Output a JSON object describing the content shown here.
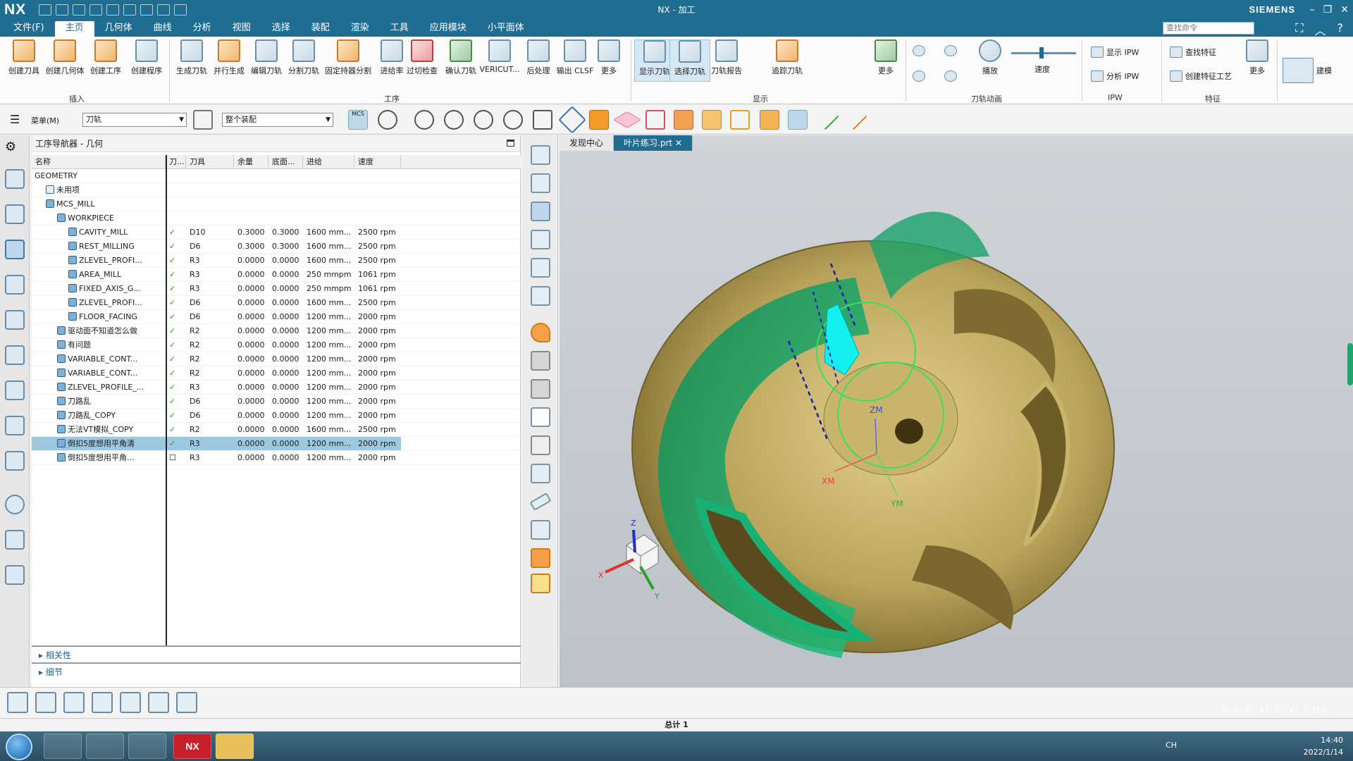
{
  "app": {
    "logo": "NX",
    "title": "NX - 加工",
    "brand": "SIEMENS",
    "window_controls": [
      "–",
      "❐",
      "✕"
    ]
  },
  "menu": {
    "tabs": [
      "文件(F)",
      "主页",
      "几何体",
      "曲线",
      "分析",
      "视图",
      "选择",
      "装配",
      "渲染",
      "工具",
      "应用模块",
      "小平面体"
    ],
    "active_tab": "主页",
    "search_placeholder": "查找命令"
  },
  "ribbon": {
    "insert_buttons": [
      "创建刀具",
      "创建几何体",
      "创建工序",
      "创建程序"
    ],
    "insert_group": "插入",
    "op_buttons": [
      "生成刀轨",
      "并行生成",
      "编辑刀轨",
      "分割刀轨",
      "固定持器分割",
      "进给率",
      "过切检查",
      "确认刀轨",
      "VERICUT...",
      "后处理",
      "输出 CLSF",
      "更多"
    ],
    "op_group": "工序",
    "display_buttons": [
      "显示刀轨",
      "选择刀轨",
      "刀轨报告",
      "追踪刀轨",
      "更多"
    ],
    "display_group": "显示",
    "anim_buttons": [
      "播放"
    ],
    "speed_label": "速度",
    "anim_group": "刀轨动画",
    "ipw_buttons": [
      "显示 IPW",
      "分析 IPW"
    ],
    "ipw_group": "IPW",
    "feature_buttons": [
      "查找特征",
      "创建特征工艺",
      "更多"
    ],
    "feature_group": "特征",
    "model_button": "建模"
  },
  "toolbar2": {
    "menu_label": "菜单(M)",
    "filter_value": "刀轨",
    "scope_value": "整个装配",
    "mcs_label": "MCS"
  },
  "navigator": {
    "title": "工序导航器 - 几何",
    "columns": [
      "名称",
      "刀...",
      "刀具",
      "余量",
      "底面...",
      "进给",
      "速度"
    ],
    "rows": [
      {
        "name": "GEOMETRY",
        "status": "",
        "tool": "",
        "stock": "",
        "floor": "",
        "feed": "",
        "speed": "",
        "indent": 0,
        "icon": ""
      },
      {
        "name": "未用项",
        "status": "",
        "tool": "",
        "stock": "",
        "floor": "",
        "feed": "",
        "speed": "",
        "indent": 1,
        "icon": "folder"
      },
      {
        "name": "MCS_MILL",
        "status": "",
        "tool": "",
        "stock": "",
        "floor": "",
        "feed": "",
        "speed": "",
        "indent": 1,
        "icon": "mcs"
      },
      {
        "name": "WORKPIECE",
        "status": "",
        "tool": "",
        "stock": "",
        "floor": "",
        "feed": "",
        "speed": "",
        "indent": 2,
        "icon": "workpiece"
      },
      {
        "name": "CAVITY_MILL",
        "status": "✓",
        "tool": "D10",
        "stock": "0.3000",
        "floor": "0.3000",
        "feed": "1600 mm...",
        "speed": "2500 rpm",
        "indent": 3,
        "icon": "op"
      },
      {
        "name": "REST_MILLING",
        "status": "✓",
        "tool": "D6",
        "stock": "0.3000",
        "floor": "0.3000",
        "feed": "1600 mm...",
        "speed": "2500 rpm",
        "indent": 3,
        "icon": "op"
      },
      {
        "name": "ZLEVEL_PROFI...",
        "status": "✓",
        "tool": "R3",
        "stock": "0.0000",
        "floor": "0.0000",
        "feed": "1600 mm...",
        "speed": "2500 rpm",
        "indent": 3,
        "icon": "op"
      },
      {
        "name": "AREA_MILL",
        "status": "✓",
        "tool": "R3",
        "stock": "0.0000",
        "floor": "0.0000",
        "feed": "250 mmpm",
        "speed": "1061 rpm",
        "indent": 3,
        "icon": "op"
      },
      {
        "name": "FIXED_AXIS_G...",
        "status": "✓",
        "tool": "R3",
        "stock": "0.0000",
        "floor": "0.0000",
        "feed": "250 mmpm",
        "speed": "1061 rpm",
        "indent": 3,
        "icon": "op"
      },
      {
        "name": "ZLEVEL_PROFI...",
        "status": "✓",
        "tool": "D6",
        "stock": "0.0000",
        "floor": "0.0000",
        "feed": "1600 mm...",
        "speed": "2500 rpm",
        "indent": 3,
        "icon": "op"
      },
      {
        "name": "FLOOR_FACING",
        "status": "✓",
        "tool": "D6",
        "stock": "0.0000",
        "floor": "0.0000",
        "feed": "1200 mm...",
        "speed": "2000 rpm",
        "indent": 3,
        "icon": "op"
      },
      {
        "name": "驱动面不知道怎么做",
        "status": "✓",
        "tool": "R2",
        "stock": "0.0000",
        "floor": "0.0000",
        "feed": "1200 mm...",
        "speed": "2000 rpm",
        "indent": 2,
        "icon": "op"
      },
      {
        "name": "有问题",
        "status": "✓",
        "tool": "R2",
        "stock": "0.0000",
        "floor": "0.0000",
        "feed": "1200 mm...",
        "speed": "2000 rpm",
        "indent": 2,
        "icon": "op"
      },
      {
        "name": "VARIABLE_CONT...",
        "status": "✓",
        "tool": "R2",
        "stock": "0.0000",
        "floor": "0.0000",
        "feed": "1200 mm...",
        "speed": "2000 rpm",
        "indent": 2,
        "icon": "op"
      },
      {
        "name": "VARIABLE_CONT...",
        "status": "✓",
        "tool": "R2",
        "stock": "0.0000",
        "floor": "0.0000",
        "feed": "1200 mm...",
        "speed": "2000 rpm",
        "indent": 2,
        "icon": "op"
      },
      {
        "name": "ZLEVEL_PROFILE_...",
        "status": "✓",
        "tool": "R3",
        "stock": "0.0000",
        "floor": "0.0000",
        "feed": "1200 mm...",
        "speed": "2000 rpm",
        "indent": 2,
        "icon": "op"
      },
      {
        "name": "刀路乱",
        "status": "✓",
        "tool": "D6",
        "stock": "0.0000",
        "floor": "0.0000",
        "feed": "1200 mm...",
        "speed": "2000 rpm",
        "indent": 2,
        "icon": "op"
      },
      {
        "name": "刀路乱_COPY",
        "status": "✓",
        "tool": "D6",
        "stock": "0.0000",
        "floor": "0.0000",
        "feed": "1200 mm...",
        "speed": "2000 rpm",
        "indent": 2,
        "icon": "op"
      },
      {
        "name": "无法VT模拟_COPY",
        "status": "✓",
        "tool": "R2",
        "stock": "0.0000",
        "floor": "0.0000",
        "feed": "1600 mm...",
        "speed": "2500 rpm",
        "indent": 2,
        "icon": "op"
      },
      {
        "name": "倒扣5度想用平角清",
        "status": "✓",
        "tool": "R3",
        "stock": "0.0000",
        "floor": "0.0000",
        "feed": "1200 mm...",
        "speed": "2000 rpm",
        "indent": 2,
        "icon": "op",
        "selected": true
      },
      {
        "name": "倒扣5度想用平角...",
        "status": "☐",
        "tool": "R3",
        "stock": "0.0000",
        "floor": "0.0000",
        "feed": "1200 mm...",
        "speed": "2000 rpm",
        "indent": 2,
        "icon": "op"
      }
    ],
    "sections": [
      "相关性",
      "细节"
    ]
  },
  "viewport": {
    "tabs": [
      "发现中心",
      "叶片练习.prt"
    ],
    "active_tab": "叶片练习.prt",
    "axis_labels": {
      "x": "X",
      "y": "Y",
      "z": "Z",
      "xm": "XM",
      "ym": "YM",
      "zm": "ZM"
    }
  },
  "status": {
    "total": "总计 1"
  },
  "taskbar": {
    "lang": "CH",
    "time": "14:40",
    "date": "2022/1/14",
    "nx_label": "NX"
  },
  "watermark": "WWW.3DSJW.COM",
  "colors": {
    "title_bar": "#1f6d91",
    "model_gold": "#b9a45a",
    "model_green": "#16a26a",
    "toolpath": "#34c95a",
    "select_row": "#9cc9e0"
  }
}
